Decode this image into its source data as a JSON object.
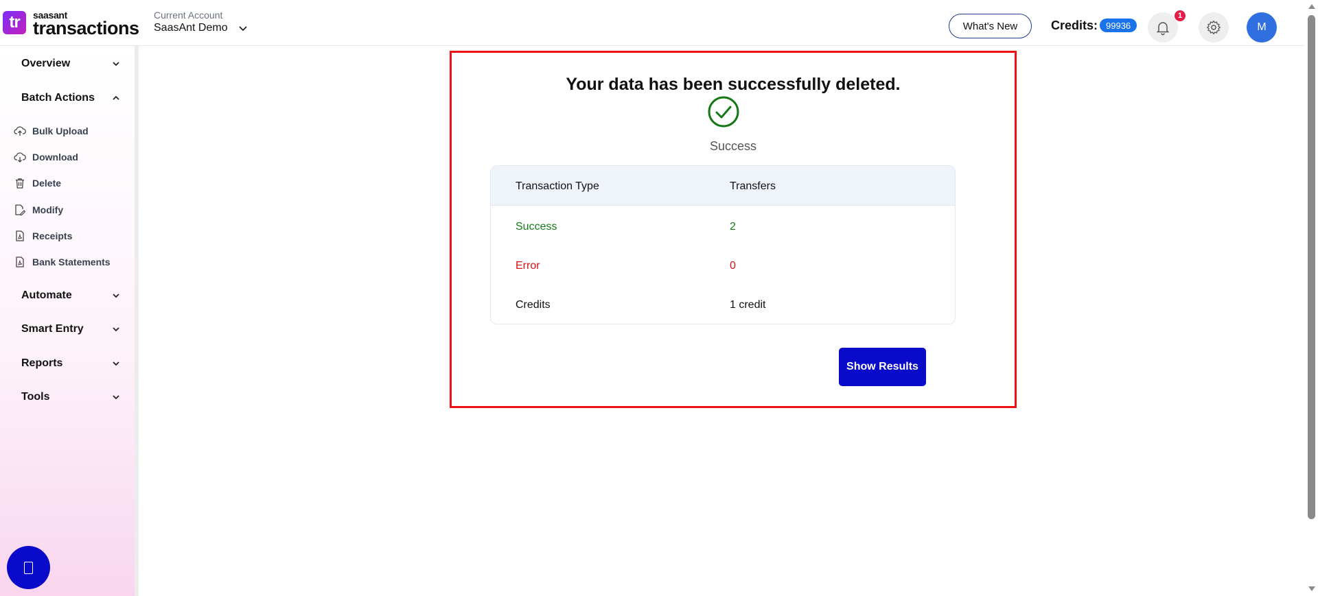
{
  "header": {
    "logo_small": "saasant",
    "logo_big": "transactions",
    "logo_mark": "tr",
    "account_label": "Current Account",
    "account_name": "SaasAnt Demo",
    "whats_new": "What's New",
    "credits_label": "Credits:",
    "credits_value": "99936",
    "notification_count": "1",
    "avatar_initial": "M"
  },
  "sidebar": {
    "sections": [
      {
        "label": "Overview",
        "state": "collapsed"
      },
      {
        "label": "Batch Actions",
        "state": "expanded"
      },
      {
        "label": "Automate",
        "state": "collapsed"
      },
      {
        "label": "Smart Entry",
        "state": "collapsed"
      },
      {
        "label": "Reports",
        "state": "collapsed"
      },
      {
        "label": "Tools",
        "state": "collapsed"
      }
    ],
    "batch_items": [
      {
        "label": "Bulk Upload",
        "icon": "cloud-upload-icon"
      },
      {
        "label": "Download",
        "icon": "cloud-download-icon"
      },
      {
        "label": "Delete",
        "icon": "trash-icon"
      },
      {
        "label": "Modify",
        "icon": "edit-file-icon"
      },
      {
        "label": "Receipts",
        "icon": "pdf-file-icon"
      },
      {
        "label": "Bank Statements",
        "icon": "pdf-file-icon"
      }
    ]
  },
  "result": {
    "title": "Your data has been successfully deleted.",
    "status": "Success",
    "table": {
      "headers": [
        "Transaction Type",
        "Transfers"
      ],
      "rows": [
        {
          "type": "Success",
          "value": "2"
        },
        {
          "type": "Error",
          "value": "0"
        },
        {
          "type": "Credits",
          "value": "1 credit"
        }
      ]
    },
    "button": "Show Results"
  },
  "colors": {
    "brand_purple": "#7b2ff7",
    "primary_blue": "#0a0acb",
    "credits_badge": "#1a73e8",
    "success_green": "#157a15",
    "error_red": "#dd1111",
    "highlight_border": "#ee1111"
  }
}
